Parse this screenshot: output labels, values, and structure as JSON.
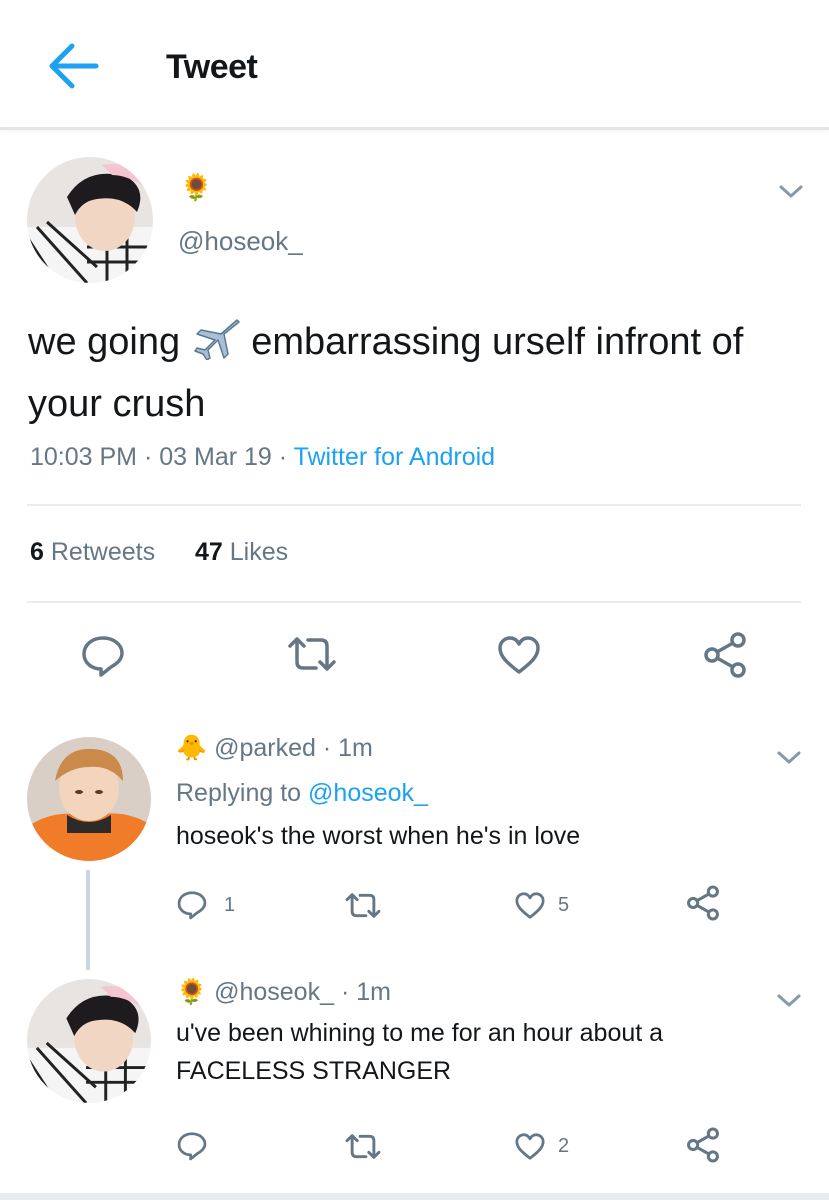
{
  "header": {
    "title": "Tweet"
  },
  "tweet": {
    "author_emoji": "🌻",
    "handle": "@hoseok_",
    "text_before": "we going",
    "text_after": "embarrassing urself infront of your crush",
    "time": "10:03 PM",
    "date": "03 Mar 19",
    "source": "Twitter for Android",
    "retweets_count": "6",
    "retweets_label": "Retweets",
    "likes_count": "47",
    "likes_label": "Likes"
  },
  "replies": [
    {
      "emoji": "🐥",
      "handle": "@parked",
      "time": "1m",
      "replying_prefix": "Replying to",
      "replying_to": "@hoseok_",
      "text": "hoseok's the worst when he's in love",
      "reply_count": "1",
      "like_count": "5"
    },
    {
      "emoji": "🌻",
      "handle": "@hoseok_",
      "time": "1m",
      "text_line1": "u've been whining to me for an hour about a",
      "text_line2": "FACELESS STRANGER",
      "like_count": "2"
    }
  ],
  "colors": {
    "accent": "#1da1f2",
    "secondary_text": "#657786",
    "divider": "#e6ecf0"
  },
  "icons": [
    "back-arrow-icon",
    "chevron-down-icon",
    "reply-icon",
    "retweet-icon",
    "like-icon",
    "share-icon",
    "airplane-icon",
    "sunflower-icon",
    "chick-icon"
  ]
}
